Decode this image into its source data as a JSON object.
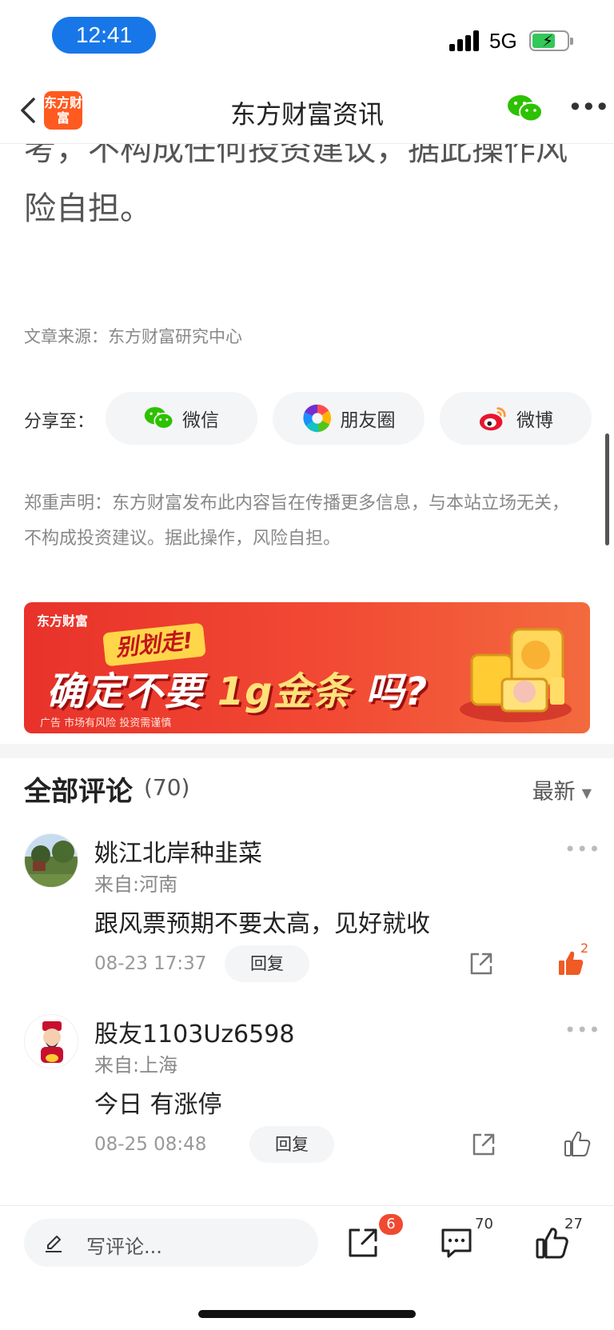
{
  "status_bar": {
    "time": "12:41",
    "network": "5G"
  },
  "nav": {
    "logo_text": "东方财富",
    "title": "东方财富资讯",
    "more": "•••"
  },
  "article": {
    "text_tail": "考，不构成任何投资建议，据此操作风险自担。",
    "source": "文章来源：东方财富研究中心"
  },
  "share": {
    "label": "分享至：",
    "items": [
      {
        "label": "微信",
        "icon": "wechat-icon"
      },
      {
        "label": "朋友圈",
        "icon": "moments-icon"
      },
      {
        "label": "微博",
        "icon": "weibo-icon"
      }
    ]
  },
  "disclaimer": {
    "title": "郑重声明：",
    "text": "东方财富发布此内容旨在传播更多信息，与本站立场无关，不构成投资建议。据此操作，风险自担。"
  },
  "ad": {
    "brand": "东方财富",
    "tag": "别划走!",
    "headline_a": "确定不要",
    "headline_b": "1g金条",
    "headline_c": "吗?",
    "note": "广告 市场有风险 投资需谨慎"
  },
  "comments": {
    "title": "全部评论",
    "count": "(70)",
    "sort": "最新",
    "items": [
      {
        "user": "姚江北岸种韭菜",
        "location": "来自:河南",
        "text": "跟风票预期不要太高，见好就收",
        "time": "08-23 17:37",
        "reply": "回复",
        "likes": "2",
        "liked": true
      },
      {
        "user": "股友1103Uz6598",
        "location": "来自:上海",
        "text": "今日 有涨停",
        "time": "08-25 08:48",
        "reply": "回复",
        "likes": "",
        "liked": false
      }
    ]
  },
  "bottom_bar": {
    "input_placeholder": "写评论...",
    "share_badge": "6",
    "comment_count": "70",
    "like_count": "27"
  },
  "colors": {
    "accent": "#f05a24",
    "primary_blue": "#1877e8",
    "wechat_green": "#2dc100"
  }
}
